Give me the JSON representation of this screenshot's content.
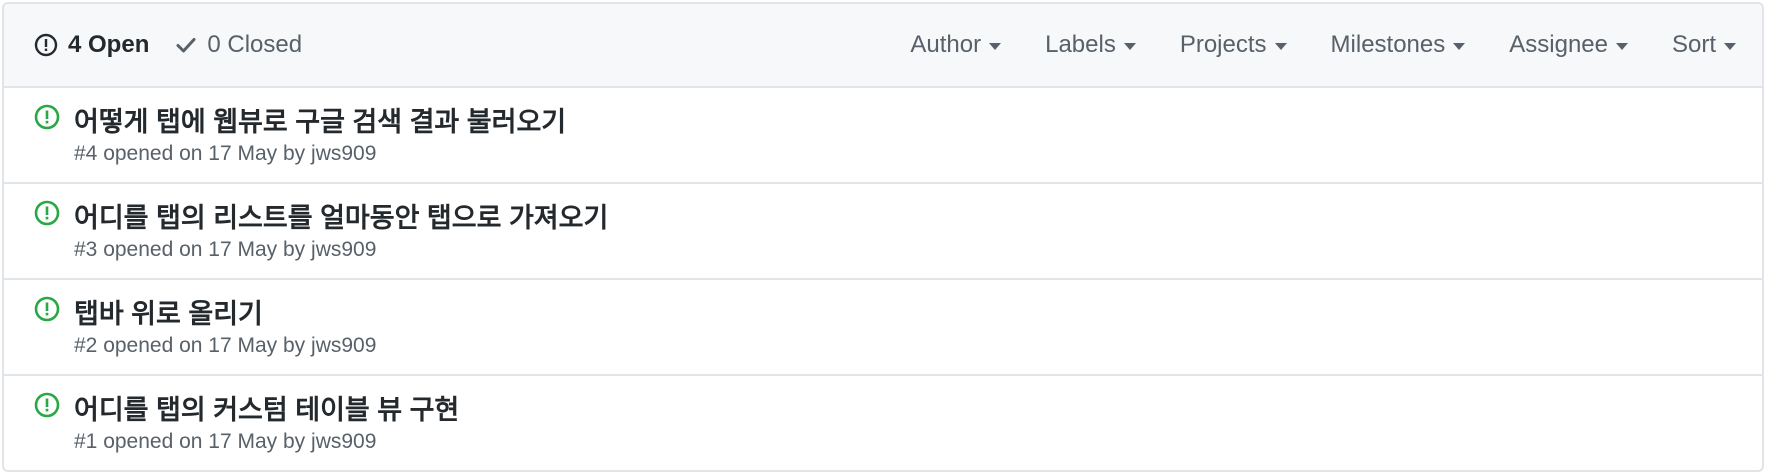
{
  "header": {
    "open_label": "4 Open",
    "closed_label": "0 Closed",
    "filters": [
      "Author",
      "Labels",
      "Projects",
      "Milestones",
      "Assignee",
      "Sort"
    ]
  },
  "issues": [
    {
      "title": "어떻게 탭에 웹뷰로 구글 검색 결과 불러오기",
      "meta_prefix": "#4 opened on 17 May by",
      "author": "jws909"
    },
    {
      "title": "어디를 탭의 리스트를 얼마동안 탭으로 가져오기",
      "meta_prefix": "#3 opened on 17 May by",
      "author": "jws909"
    },
    {
      "title": "탭바 위로 올리기",
      "meta_prefix": "#2 opened on 17 May by",
      "author": "jws909"
    },
    {
      "title": "어디를 탭의 커스텀 테이블 뷰 구현",
      "meta_prefix": "#1 opened on 17 May by",
      "author": "jws909"
    }
  ],
  "colors": {
    "open_icon": "#28a745",
    "header_bg": "#f6f8fa",
    "border": "#e1e4e8",
    "muted_text": "#586069",
    "title_text": "#24292e"
  },
  "icons": {
    "open_state": "issue-opened-icon",
    "closed_state": "check-icon",
    "dropdown": "caret-down-icon"
  }
}
